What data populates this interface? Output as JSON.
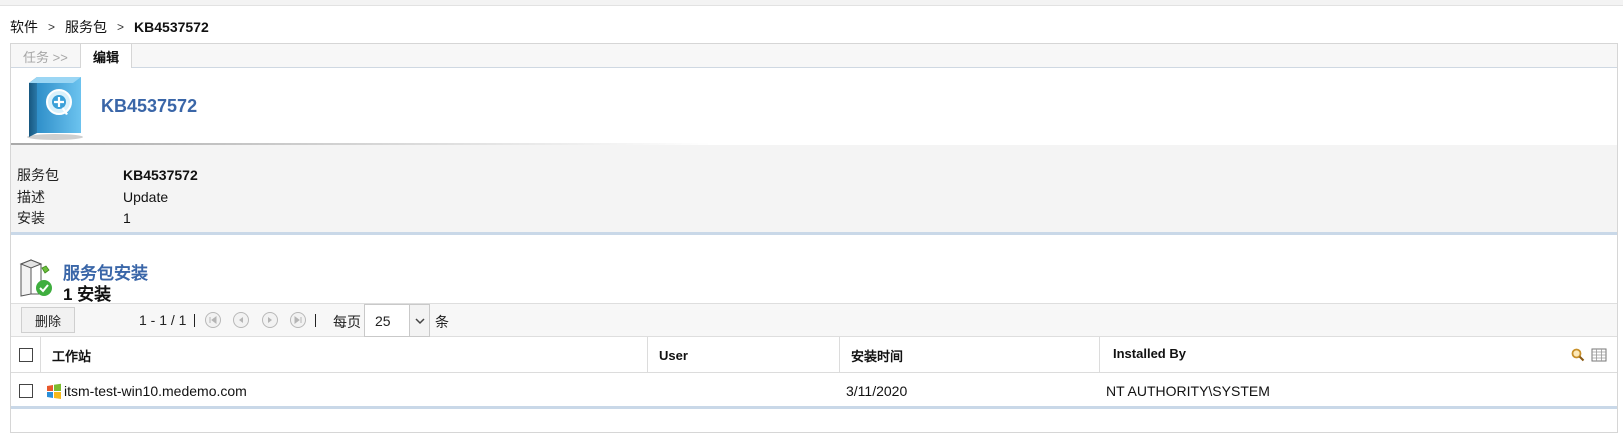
{
  "breadcrumb": {
    "items": [
      "软件",
      "服务包",
      "KB4537572"
    ],
    "separator": ">"
  },
  "tabs": {
    "tasks_label": "任务 >>",
    "edit_label": "编辑"
  },
  "product": {
    "title": "KB4537572",
    "icon": "software-box-icon"
  },
  "details": {
    "service_pack_label": "服务包",
    "service_pack_value": "KB4537572",
    "description_label": "描述",
    "description_value": "Update",
    "installs_label": "安装",
    "installs_value": "1"
  },
  "section": {
    "title": "服务包安装",
    "subtitle": "1 安装",
    "icon": "installation-check-icon"
  },
  "toolbar": {
    "delete_label": "删除",
    "range_text": "1 - 1 / 1",
    "per_page_label": "每页",
    "per_page_value": "25",
    "unit_label": "条"
  },
  "table": {
    "columns": [
      "工作站",
      "User",
      "安装时间",
      "Installed By"
    ],
    "rows": [
      {
        "workstation": "itsm-test-win10.medemo.com",
        "user": "",
        "install_time": "3/11/2020",
        "installed_by": "NT AUTHORITY\\SYSTEM"
      }
    ]
  },
  "colors": {
    "title_blue": "#3a66a8",
    "accent_border": "#c9d8e8"
  }
}
